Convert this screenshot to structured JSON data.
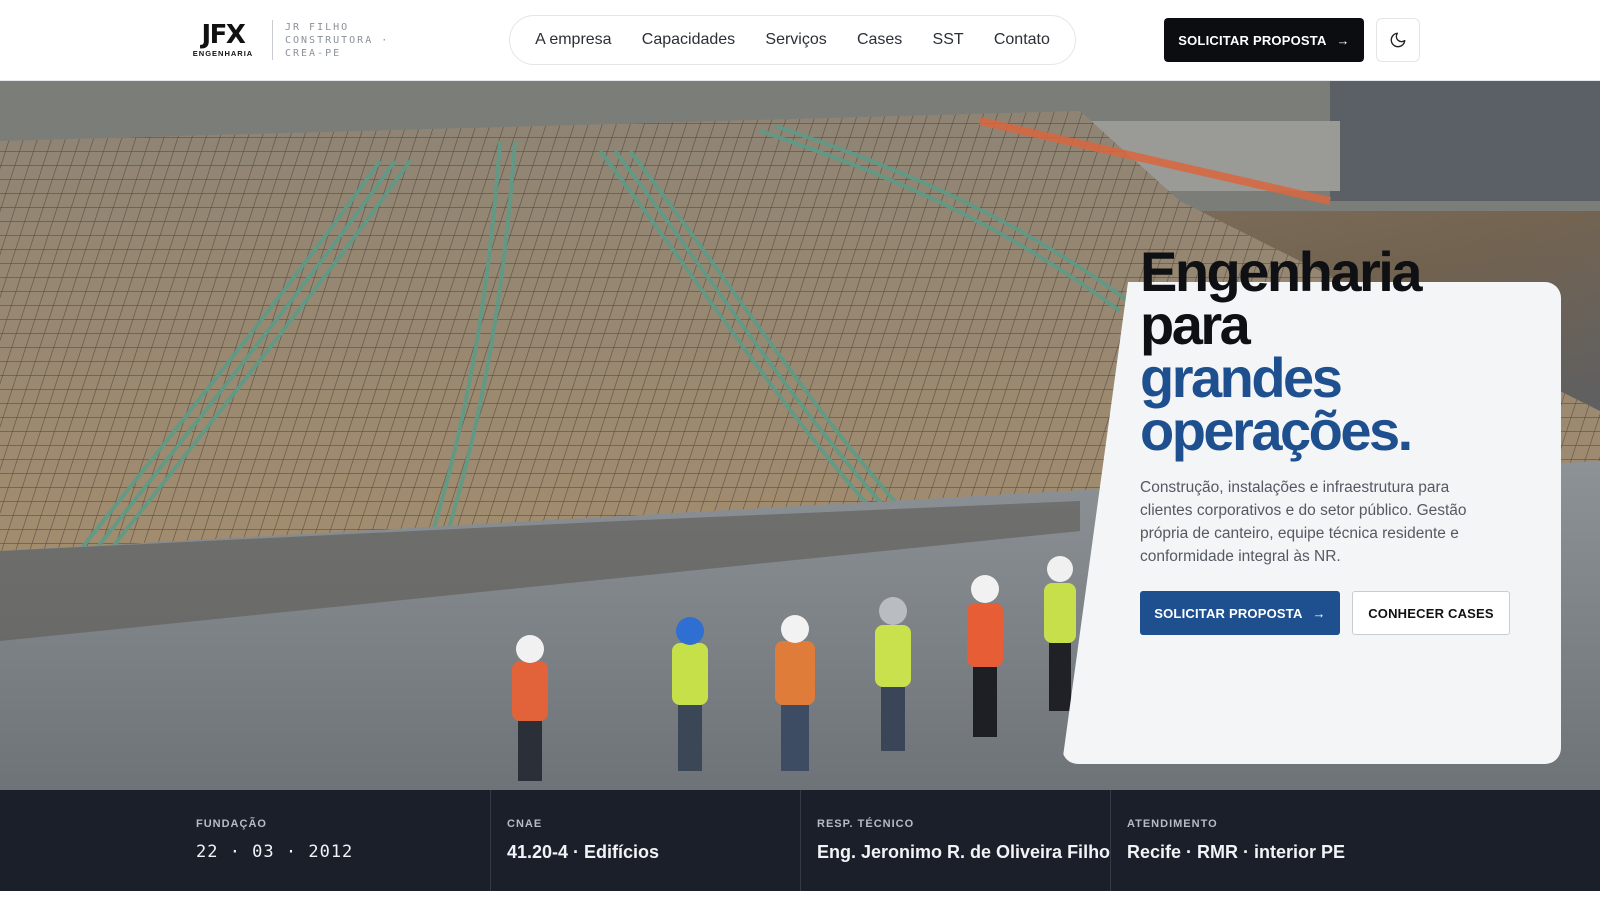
{
  "brand": {
    "logo_letters": "JFX",
    "logo_sub": "ENGENHARIA",
    "tagline_lines": [
      "JR FILHO",
      "CONSTRUTORA ·",
      "CREA-PE"
    ]
  },
  "nav": {
    "items": [
      {
        "label": "A empresa"
      },
      {
        "label": "Capacidades"
      },
      {
        "label": "Serviços"
      },
      {
        "label": "Cases"
      },
      {
        "label": "SST"
      },
      {
        "label": "Contato"
      }
    ]
  },
  "header": {
    "cta_label": "SOLICITAR PROPOSTA",
    "cta_arrow": "→",
    "theme_toggle_icon": "moon-icon"
  },
  "hero": {
    "title_lines": [
      "Engenharia",
      "para"
    ],
    "title_accent_lines": [
      "grandes",
      "operações."
    ],
    "description": "Construção, instalações e infraestrutura para clientes corporativos e do setor público. Gestão própria de canteiro, equipe técnica residente e conformidade integral às NR.",
    "primary_button": "SOLICITAR PROPOSTA",
    "primary_arrow": "→",
    "secondary_button": "CONHECER CASES"
  },
  "stats": [
    {
      "label": "FUNDAÇÃO",
      "value": "22 · 03 · 2012"
    },
    {
      "label": "CNAE",
      "value": "41.20-4 · Edifícios"
    },
    {
      "label": "RESP. TÉCNICO",
      "value": "Eng. Jeronimo R. de Oliveira Filho"
    },
    {
      "label": "ATENDIMENTO",
      "value": "Recife · RMR · interior PE"
    }
  ],
  "colors": {
    "accent": "#1e4f8f",
    "dark": "#0b0d10",
    "stats_bg": "#1a1f29"
  }
}
